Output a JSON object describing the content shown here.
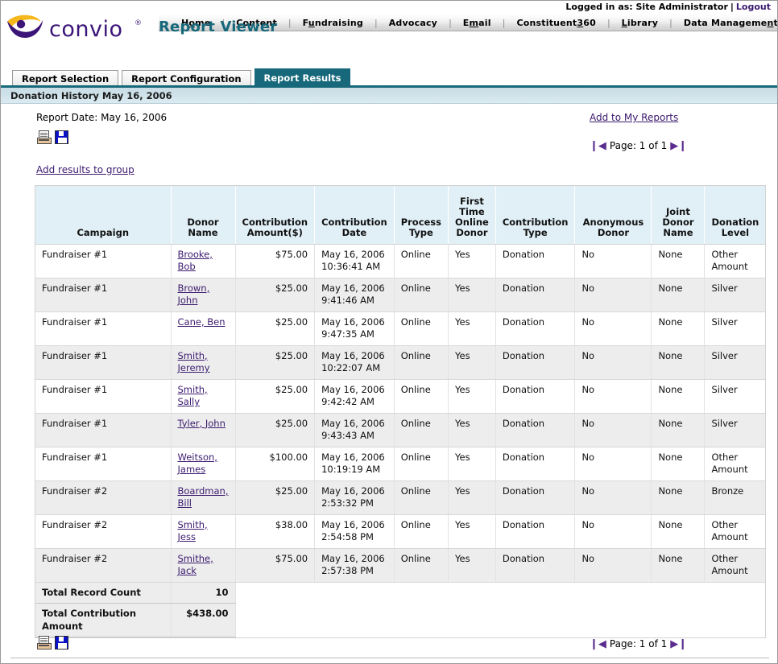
{
  "topbar": {
    "logged_in_label": "Logged in as: Site Administrator",
    "separator": "|",
    "logout_label": "Logout"
  },
  "brand": {
    "name": "convio",
    "registered_mark": "®"
  },
  "nav": {
    "separator": "|",
    "items": [
      {
        "label": "Home",
        "accesskey_index": 1
      },
      {
        "label": "Content",
        "accesskey_index": 0
      },
      {
        "label": "Fundraising",
        "accesskey_index": 1
      },
      {
        "label": "Advocacy",
        "accesskey_index": 8
      },
      {
        "label": "Email",
        "accesskey_index": 1
      },
      {
        "label": "Constituent360",
        "accesskey_index": 11
      },
      {
        "label": "Library",
        "accesskey_index": 0
      },
      {
        "label": "Data Management",
        "accesskey_index": 13
      }
    ]
  },
  "page_title": "Report Viewer",
  "tabs": [
    {
      "label": "Report Selection",
      "active": false
    },
    {
      "label": "Report Configuration",
      "active": false
    },
    {
      "label": "Report Results",
      "active": true
    }
  ],
  "section_header": "Donation History May 16, 2006",
  "toolbar": {
    "report_date_label": "Report Date: May 16, 2006",
    "add_to_my_reports_label": "Add to My Reports",
    "add_results_to_group_label": "Add results to group",
    "print_icon": "print-icon",
    "save_icon": "save-icon"
  },
  "pager": {
    "first_glyph": "❙◀",
    "prev_glyph": "◀",
    "text": "Page: 1 of 1",
    "next_glyph": "▶",
    "last_glyph": "▶❙"
  },
  "table": {
    "columns": [
      "Campaign",
      "Donor Name",
      "Contribution Amount($)",
      "Contribution Date",
      "Process Type",
      "First Time Online Donor",
      "Contribution Type",
      "Anonymous Donor",
      "Joint Donor Name",
      "Donation Level"
    ],
    "rows": [
      {
        "campaign": "Fundraiser #1",
        "donor": "Brooke, Bob",
        "amount": "$75.00",
        "date": "May 16, 2006 10:36:41 AM",
        "process_type": "Online",
        "first_time_online_donor": "Yes",
        "contribution_type": "Donation",
        "anonymous_donor": "No",
        "joint_donor_name": "None",
        "donation_level": "Other Amount"
      },
      {
        "campaign": "Fundraiser #1",
        "donor": "Brown, John",
        "amount": "$25.00",
        "date": "May 16, 2006 9:41:46 AM",
        "process_type": "Online",
        "first_time_online_donor": "Yes",
        "contribution_type": "Donation",
        "anonymous_donor": "No",
        "joint_donor_name": "None",
        "donation_level": "Silver"
      },
      {
        "campaign": "Fundraiser #1",
        "donor": "Cane, Ben",
        "amount": "$25.00",
        "date": "May 16, 2006 9:47:35 AM",
        "process_type": "Online",
        "first_time_online_donor": "Yes",
        "contribution_type": "Donation",
        "anonymous_donor": "No",
        "joint_donor_name": "None",
        "donation_level": "Silver"
      },
      {
        "campaign": "Fundraiser #1",
        "donor": "Smith, Jeremy",
        "amount": "$25.00",
        "date": "May 16, 2006 10:22:07 AM",
        "process_type": "Online",
        "first_time_online_donor": "Yes",
        "contribution_type": "Donation",
        "anonymous_donor": "No",
        "joint_donor_name": "None",
        "donation_level": "Silver"
      },
      {
        "campaign": "Fundraiser #1",
        "donor": "Smith, Sally",
        "amount": "$25.00",
        "date": "May 16, 2006 9:42:42 AM",
        "process_type": "Online",
        "first_time_online_donor": "Yes",
        "contribution_type": "Donation",
        "anonymous_donor": "No",
        "joint_donor_name": "None",
        "donation_level": "Silver"
      },
      {
        "campaign": "Fundraiser #1",
        "donor": "Tyler, John",
        "amount": "$25.00",
        "date": "May 16, 2006 9:43:43 AM",
        "process_type": "Online",
        "first_time_online_donor": "Yes",
        "contribution_type": "Donation",
        "anonymous_donor": "No",
        "joint_donor_name": "None",
        "donation_level": "Silver"
      },
      {
        "campaign": "Fundraiser #1",
        "donor": "Weitson, James",
        "amount": "$100.00",
        "date": "May 16, 2006 10:19:19 AM",
        "process_type": "Online",
        "first_time_online_donor": "Yes",
        "contribution_type": "Donation",
        "anonymous_donor": "No",
        "joint_donor_name": "None",
        "donation_level": "Other Amount"
      },
      {
        "campaign": "Fundraiser #2",
        "donor": "Boardman, Bill",
        "amount": "$25.00",
        "date": "May 16, 2006 2:53:32 PM",
        "process_type": "Online",
        "first_time_online_donor": "Yes",
        "contribution_type": "Donation",
        "anonymous_donor": "No",
        "joint_donor_name": "None",
        "donation_level": "Bronze"
      },
      {
        "campaign": "Fundraiser #2",
        "donor": "Smith, Jess",
        "amount": "$38.00",
        "date": "May 16, 2006 2:54:58 PM",
        "process_type": "Online",
        "first_time_online_donor": "Yes",
        "contribution_type": "Donation",
        "anonymous_donor": "No",
        "joint_donor_name": "None",
        "donation_level": "Other Amount"
      },
      {
        "campaign": "Fundraiser #2",
        "donor": "Smithe, Jack",
        "amount": "$75.00",
        "date": "May 16, 2006 2:57:38 PM",
        "process_type": "Online",
        "first_time_online_donor": "Yes",
        "contribution_type": "Donation",
        "anonymous_donor": "No",
        "joint_donor_name": "None",
        "donation_level": "Other Amount"
      }
    ],
    "totals": [
      {
        "label": "Total Record Count",
        "value": "10"
      },
      {
        "label": "Total Contribution Amount",
        "value": "$438.00"
      }
    ]
  },
  "colors": {
    "teal": "#16687a",
    "link_purple": "#3b1a6e",
    "header_blue": "#e1f0f7",
    "section_band": "#cfe2ea",
    "brand_purple": "#3b1578",
    "brand_gold": "#f5b81c"
  }
}
